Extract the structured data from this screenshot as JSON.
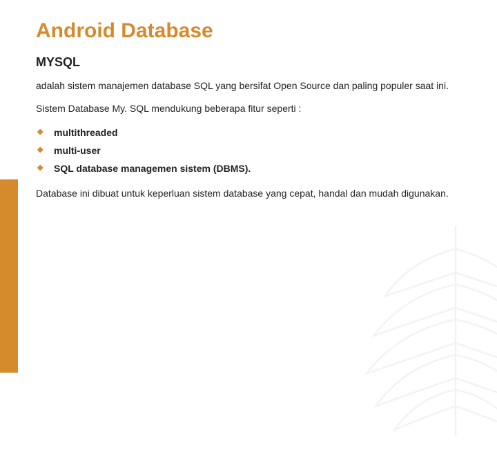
{
  "title": "Android Database",
  "subtitle": "MYSQL",
  "intro": "adalah sistem manajemen database SQL yang bersifat Open Source dan paling populer saat ini.",
  "support_line": "Sistem Database My. SQL mendukung beberapa fitur seperti :",
  "features": [
    "multithreaded",
    "multi-user",
    "SQL database managemen sistem (DBMS)."
  ],
  "closing": "Database ini dibuat untuk keperluan sistem database yang cepat, handal dan mudah digunakan."
}
